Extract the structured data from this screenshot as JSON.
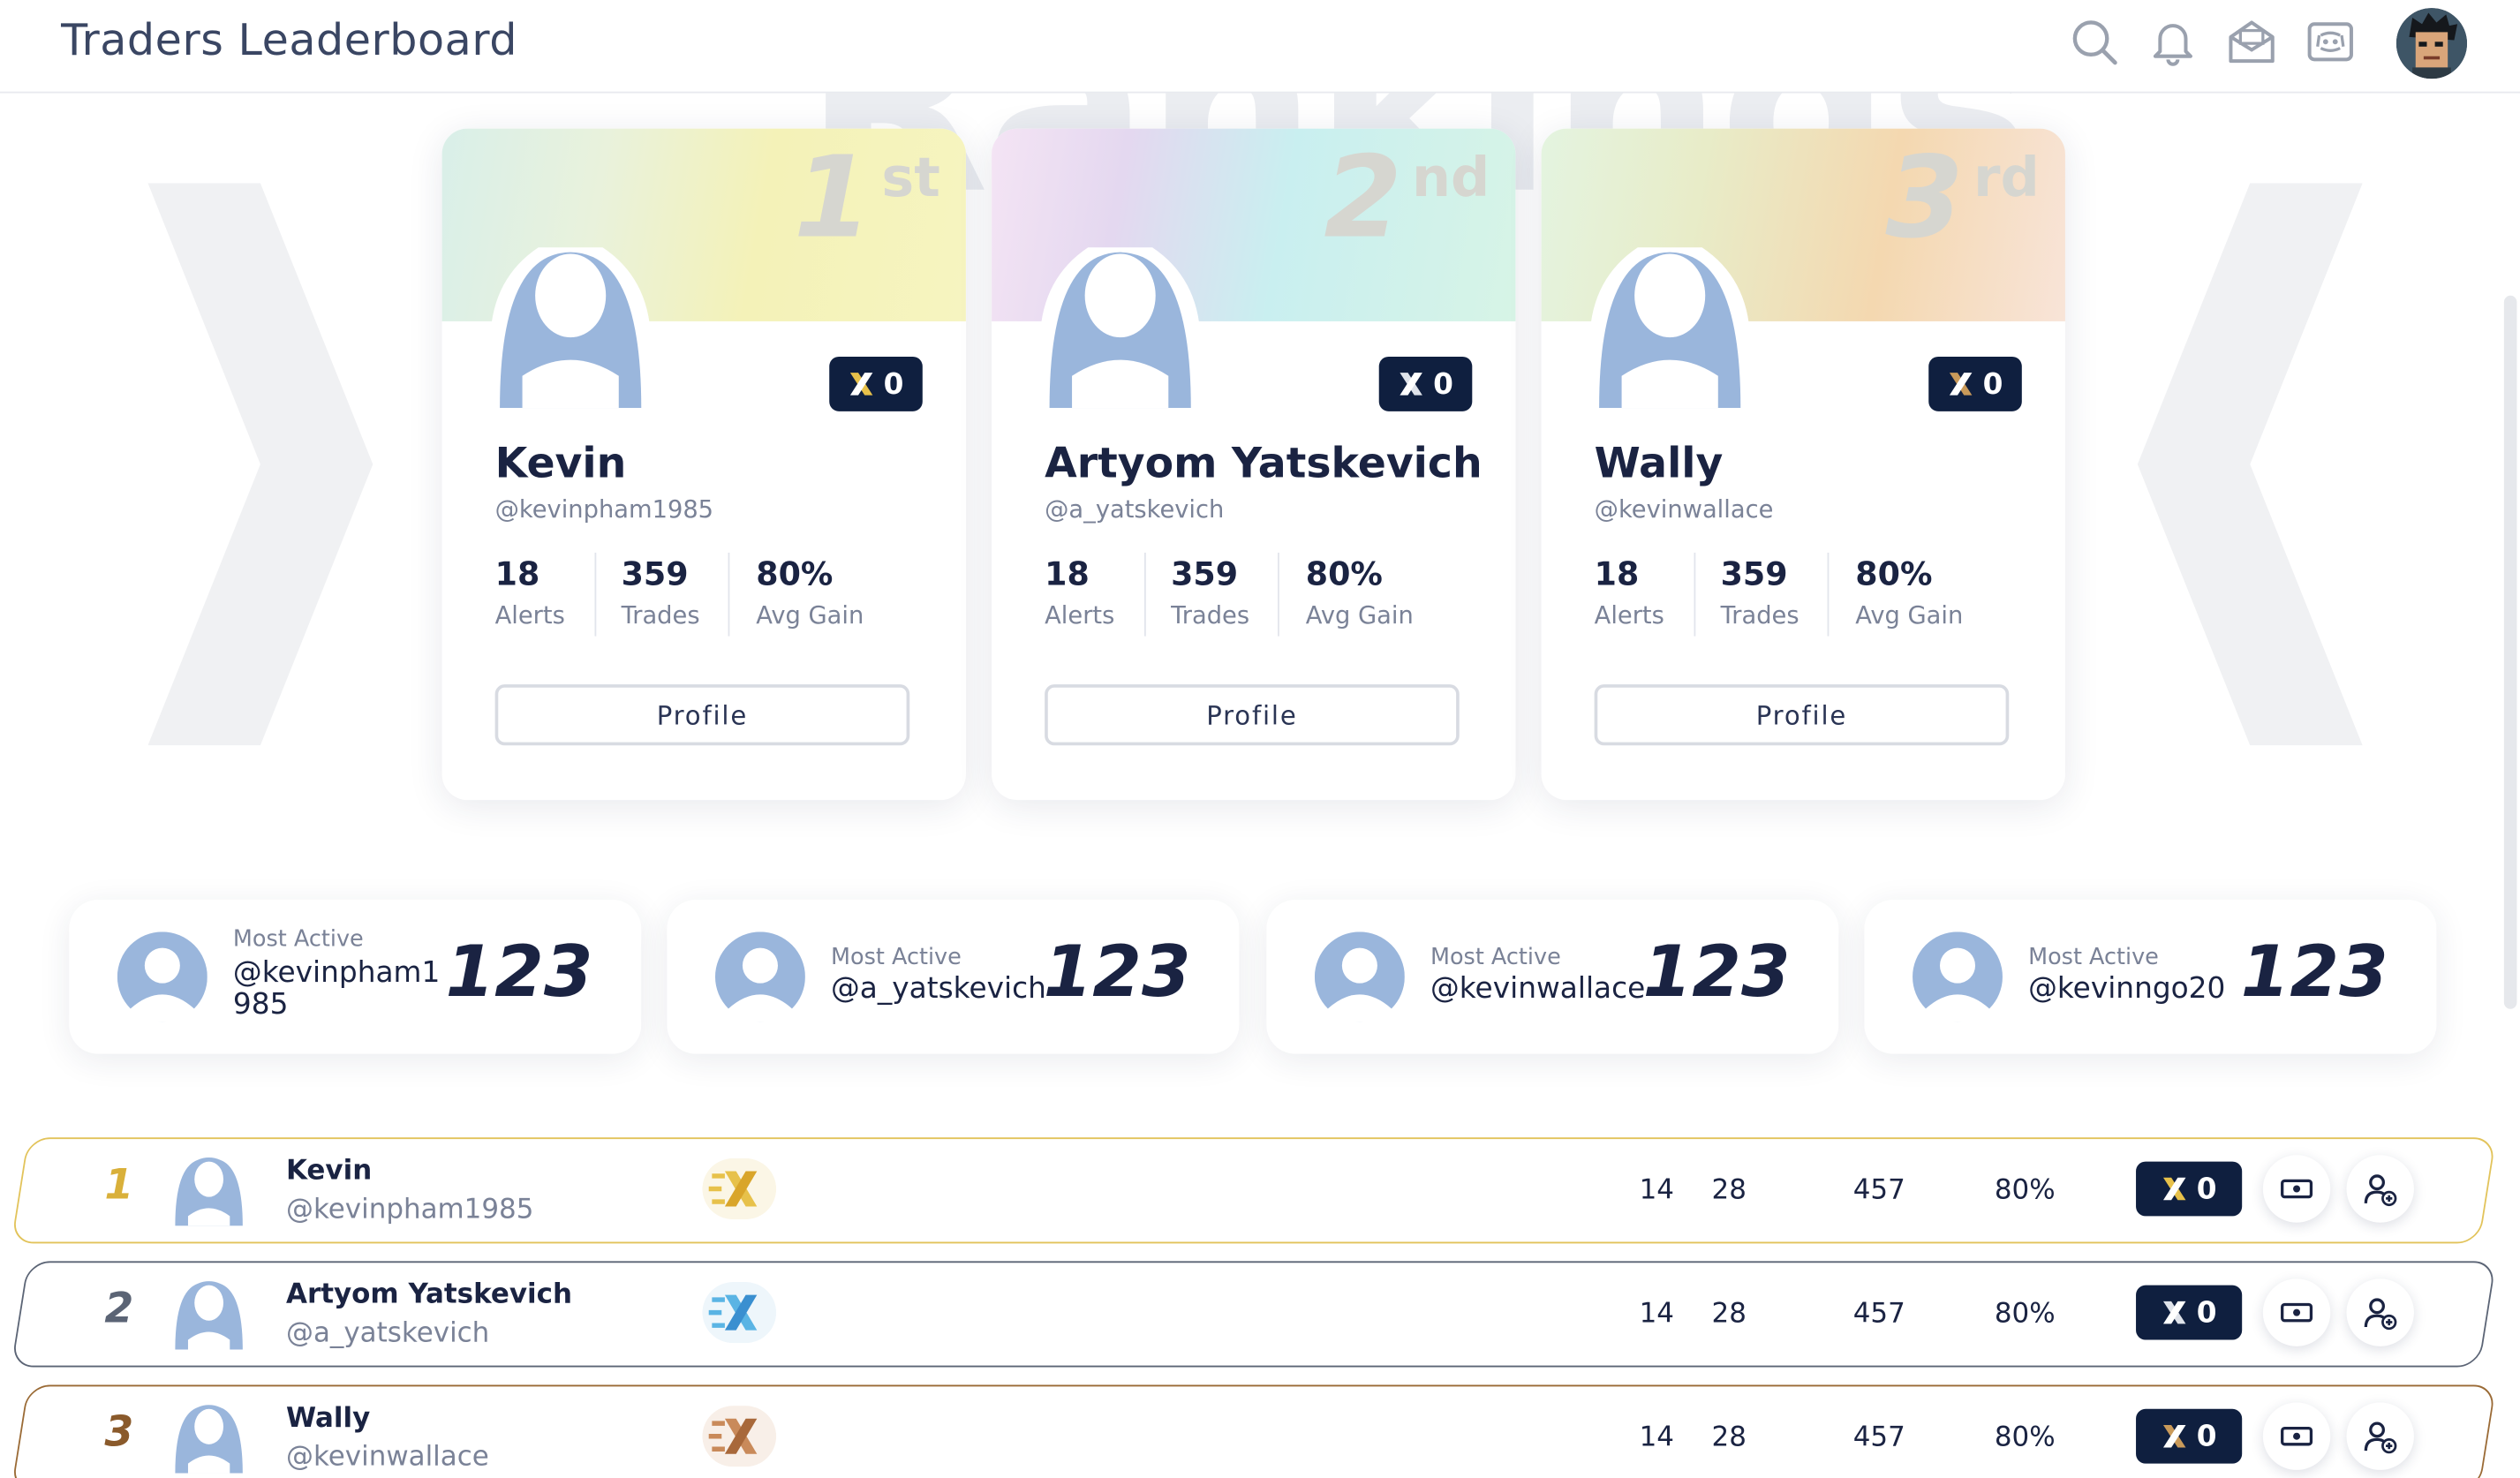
{
  "header": {
    "title": "Traders Leaderboard",
    "icons": [
      "search-icon",
      "bell-icon",
      "mail-icon",
      "discord-icon"
    ]
  },
  "background": {
    "word": "Rankings"
  },
  "top_cards": [
    {
      "rank": "1",
      "suffix": "st",
      "name": "Kevin",
      "handle": "@kevinpham1985",
      "badge": "0",
      "alerts": "18",
      "alerts_label": "Alerts",
      "trades": "359",
      "trades_label": "Trades",
      "gain": "80%",
      "gain_label": "Avg Gain",
      "button": "Profile"
    },
    {
      "rank": "2",
      "suffix": "nd",
      "name": "Artyom Yatskevich",
      "handle": "@a_yatskevich",
      "badge": "0",
      "alerts": "18",
      "alerts_label": "Alerts",
      "trades": "359",
      "trades_label": "Trades",
      "gain": "80%",
      "gain_label": "Avg Gain",
      "button": "Profile"
    },
    {
      "rank": "3",
      "suffix": "rd",
      "name": "Wally",
      "handle": "@kevinwallace",
      "badge": "0",
      "alerts": "18",
      "alerts_label": "Alerts",
      "trades": "359",
      "trades_label": "Trades",
      "gain": "80%",
      "gain_label": "Avg Gain",
      "button": "Profile"
    }
  ],
  "most_active": [
    {
      "label": "Most Active",
      "handle": "@kevinpham1985",
      "count": "123"
    },
    {
      "label": "Most Active",
      "handle": "@a_yatskevich",
      "count": "123"
    },
    {
      "label": "Most Active",
      "handle": "@kevinwallace",
      "count": "123"
    },
    {
      "label": "Most Active",
      "handle": "@kevinngo20",
      "count": "123"
    }
  ],
  "rows": [
    {
      "rank": "1",
      "name": "Kevin",
      "handle": "@kevinpham1985",
      "c1": "14",
      "c2": "28",
      "c3": "457",
      "c4": "80%",
      "badge": "0"
    },
    {
      "rank": "2",
      "name": "Artyom Yatskevich",
      "handle": "@a_yatskevich",
      "c1": "14",
      "c2": "28",
      "c3": "457",
      "c4": "80%",
      "badge": "0"
    },
    {
      "rank": "3",
      "name": "Wally",
      "handle": "@kevinwallace",
      "c1": "14",
      "c2": "28",
      "c3": "457",
      "c4": "80%",
      "badge": "0"
    }
  ],
  "colors": {
    "navy": "#0f1f3f",
    "gold": "#d9b03a",
    "silver": "#5b6475",
    "bronze": "#8a5a2b",
    "avatar": "#9ab6dc"
  }
}
